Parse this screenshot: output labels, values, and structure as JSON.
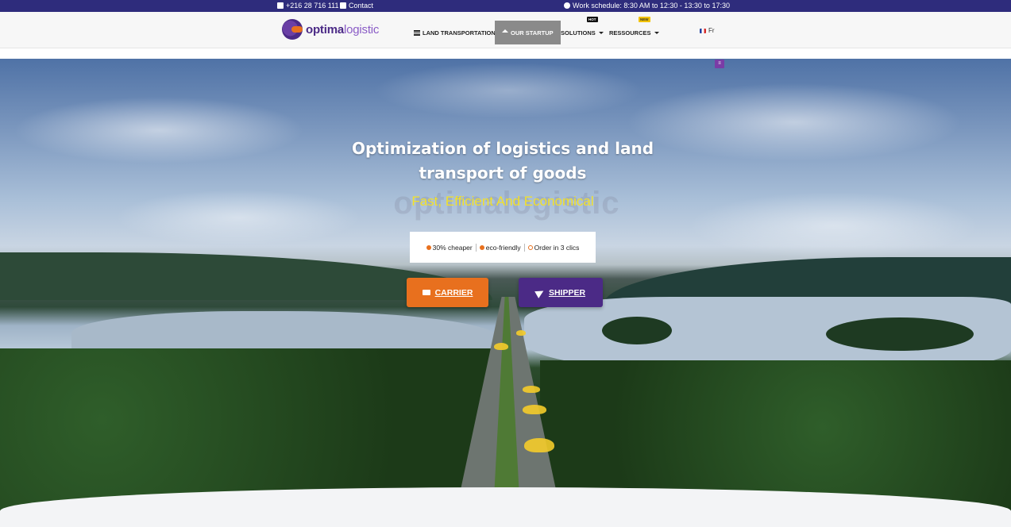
{
  "topbar": {
    "phone": "+216 28 716 111",
    "contact": "Contact",
    "schedule": "Work schedule: 8:30 AM to 12:30 - 13:30 to 17:30"
  },
  "header": {
    "logo_bold": "optima",
    "logo_light": "logistic",
    "nav": [
      {
        "label": "LAND TRANSPORTATION"
      },
      {
        "label": "OUR STARTUP"
      },
      {
        "label": "SOLUTIONS",
        "badge": "HOT"
      },
      {
        "label": "RESSOURCES",
        "badge": "NEW"
      }
    ],
    "language": "Fr"
  },
  "hero": {
    "title_line1": "Optimization of logistics and land",
    "title_line2": "transport of goods",
    "watermark": "optimalogistic",
    "subtitle": "Fast, Efficient And Economical",
    "features": [
      "30% cheaper",
      "eco-friendly",
      "Order in 3 clics"
    ],
    "carrier_label": "CARRIER",
    "shipper_label": "SHIPPER",
    "menu_badge": "≡"
  },
  "colors": {
    "topbar": "#2e2c7c",
    "brand_purple": "#4b2a86",
    "brand_orange": "#e8701e",
    "subtitle_yellow": "#f2e02a"
  }
}
